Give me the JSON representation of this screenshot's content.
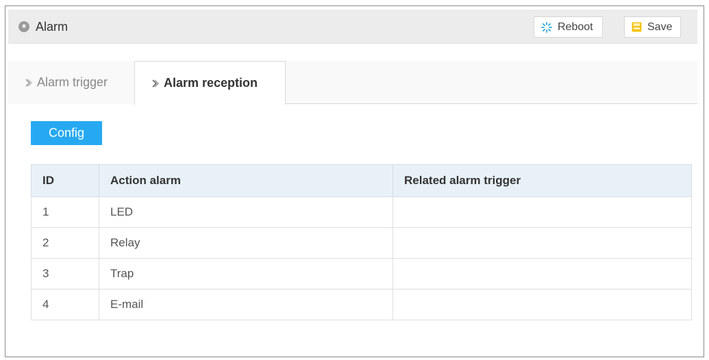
{
  "header": {
    "title": "Alarm",
    "reboot_label": "Reboot",
    "save_label": "Save",
    "icons": {
      "title": "location-pin-icon",
      "reboot": "spinner-icon",
      "save": "floppy-disk-icon"
    },
    "colors": {
      "save_icon": "#f5c518",
      "reboot_icon": "#29a8e0"
    }
  },
  "tabs": [
    {
      "label": "Alarm trigger",
      "active": false
    },
    {
      "label": "Alarm reception",
      "active": true
    }
  ],
  "config_label": "Config",
  "table": {
    "columns": [
      "ID",
      "Action alarm",
      "Related alarm trigger"
    ],
    "rows": [
      {
        "id": "1",
        "action": "LED",
        "trigger": ""
      },
      {
        "id": "2",
        "action": "Relay",
        "trigger": ""
      },
      {
        "id": "3",
        "action": "Trap",
        "trigger": ""
      },
      {
        "id": "4",
        "action": "E-mail",
        "trigger": ""
      }
    ]
  },
  "colors": {
    "accent": "#27a9f2",
    "table_header_bg": "#e8f1f8"
  }
}
